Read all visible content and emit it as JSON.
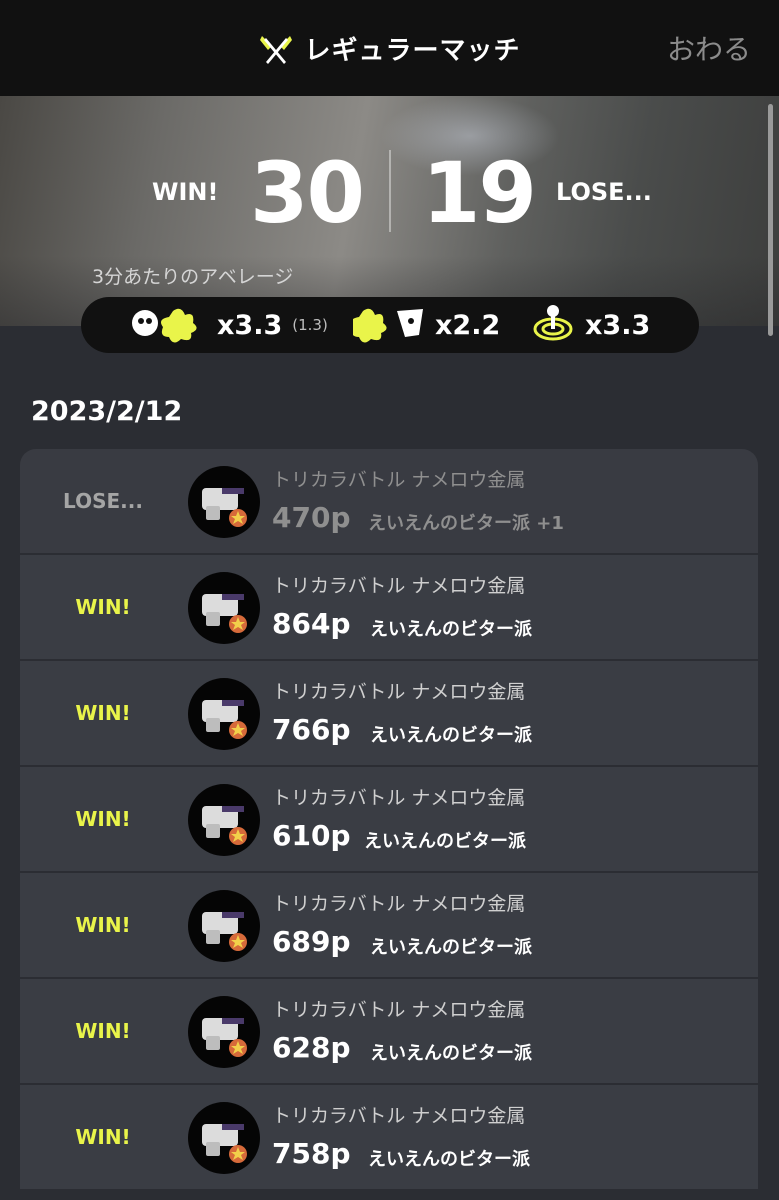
{
  "header": {
    "title": "レギュラーマッチ",
    "quit_label": "おわる",
    "mode_icon": "regular-battle-icon"
  },
  "summary": {
    "win_label": "WIN!",
    "win_count": "30",
    "lose_count": "19",
    "lose_label": "LOSE...",
    "avg_label": "3分あたりのアベレージ",
    "stats": [
      {
        "icon": "splat-icon",
        "value": "x3.3",
        "sub": "(1.3)"
      },
      {
        "icon": "death-icon",
        "value": "x2.2"
      },
      {
        "icon": "special-icon",
        "value": "x3.3"
      }
    ]
  },
  "date": "2023/2/12",
  "matches": [
    {
      "result": "LOSE...",
      "stage": "トリカラバトル ナメロウ金属",
      "points": "470p",
      "tag": "えいえんのビター派 +1"
    },
    {
      "result": "WIN!",
      "stage": "トリカラバトル ナメロウ金属",
      "points": "864p",
      "tag": "えいえんのビター派"
    },
    {
      "result": "WIN!",
      "stage": "トリカラバトル ナメロウ金属",
      "points": "766p",
      "tag": "えいえんのビター派"
    },
    {
      "result": "WIN!",
      "stage": "トリカラバトル ナメロウ金属",
      "points": "610p",
      "tag": "えいえんのビター派"
    },
    {
      "result": "WIN!",
      "stage": "トリカラバトル ナメロウ金属",
      "points": "689p",
      "tag": "えいえんのビター派"
    },
    {
      "result": "WIN!",
      "stage": "トリカラバトル ナメロウ金属",
      "points": "628p",
      "tag": "えいえんのビター派"
    },
    {
      "result": "WIN!",
      "stage": "トリカラバトル ナメロウ金属",
      "points": "758p",
      "tag": "えいえんのビター派"
    }
  ],
  "colors": {
    "win": "#e9f44a",
    "lose": "#a5a5a5",
    "accent": "#e9f44a"
  }
}
